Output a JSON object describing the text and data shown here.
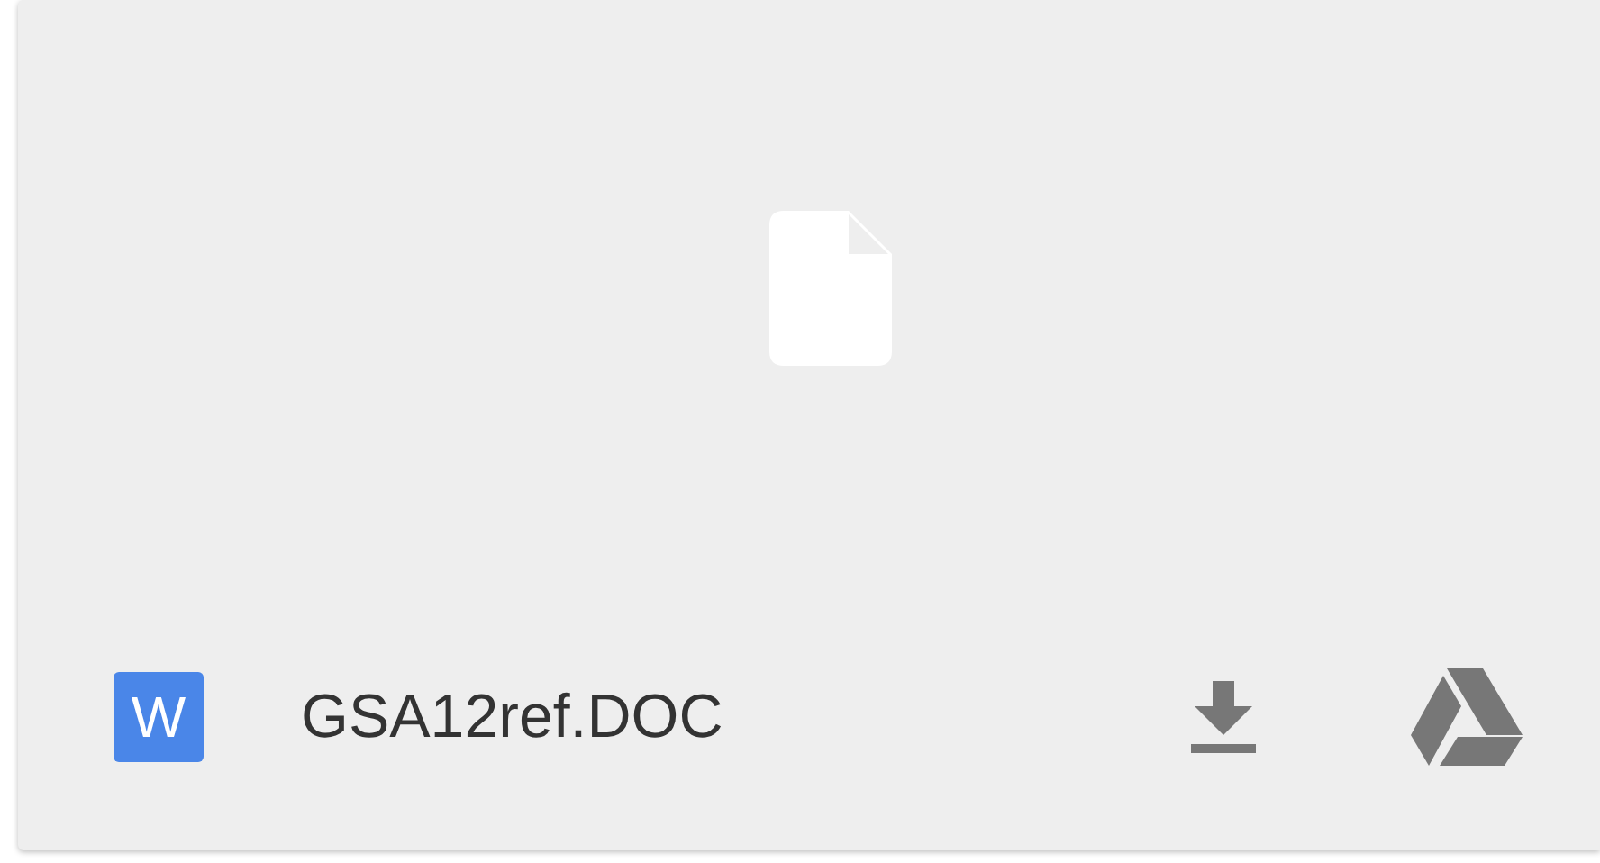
{
  "attachment": {
    "type_badge": "W",
    "file_name": "GSA12ref.DOC"
  }
}
